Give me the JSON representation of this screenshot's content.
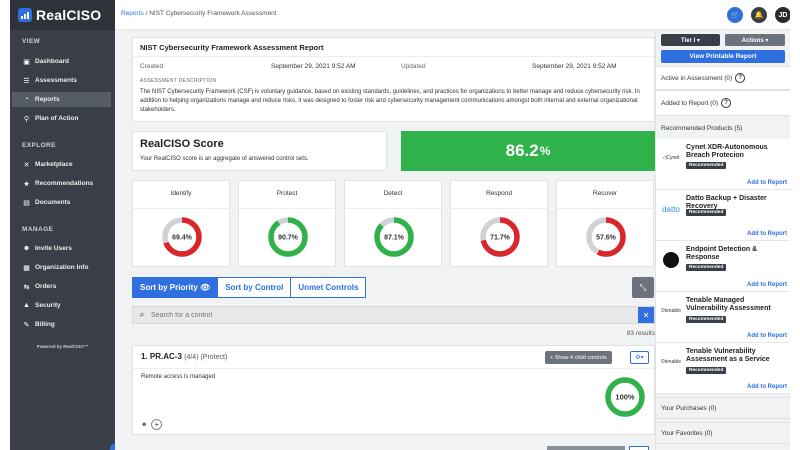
{
  "sidebar": {
    "logo": "RealCISO",
    "sections": {
      "view": "VIEW",
      "explore": "EXPLORE",
      "manage": "MANAGE"
    },
    "items": [
      {
        "label": "Dashboard",
        "icon": "dashboard-icon",
        "glyph": "▣"
      },
      {
        "label": "Assessments",
        "icon": "list-icon",
        "glyph": "☰"
      },
      {
        "label": "Reports",
        "icon": "pie-chart-icon",
        "glyph": "◔"
      },
      {
        "label": "Plan of Action",
        "icon": "pin-icon",
        "glyph": "⚲"
      },
      {
        "label": "Marketplace",
        "icon": "marketplace-icon",
        "glyph": "✕"
      },
      {
        "label": "Recommendations",
        "icon": "star-icon",
        "glyph": "★"
      },
      {
        "label": "Documents",
        "icon": "document-icon",
        "glyph": "▤"
      },
      {
        "label": "Invite Users",
        "icon": "users-icon",
        "glyph": "☻"
      },
      {
        "label": "Organization Info",
        "icon": "building-icon",
        "glyph": "▦"
      },
      {
        "label": "Orders",
        "icon": "orders-icon",
        "glyph": "⇆"
      },
      {
        "label": "Security",
        "icon": "lock-icon",
        "glyph": "🔒"
      },
      {
        "label": "Billing",
        "icon": "edit-icon",
        "glyph": "✎"
      }
    ],
    "powered": "Powered by RealCISO™"
  },
  "topbar": {
    "crumb_link": "Reports",
    "crumb_sep": "/",
    "crumb_current": "NIST Cybersecurity Framework Assessment",
    "avatar": "JD"
  },
  "report": {
    "title": "NIST Cybersecurity Framework Assessment Report",
    "created_label": "Created",
    "created_value": "September 29, 2021 9:52 AM",
    "updated_label": "Updated",
    "updated_value": "September 29, 2021 9:52 AM",
    "desc_label": "ASSESSMENT DESCRIPTION",
    "description": "The NIST Cybersecurity Framework (CSF) is voluntary guidance, based on existing standards, guidelines, and practices for organizations to better manage and reduce cybersecurity risk. In addition to helping organizations manage and reduce risks, it was designed to foster risk and cybersecurity management communications amongst both internal and external organizational stakeholders."
  },
  "score": {
    "title": "RealCISO Score",
    "subtitle": "Your RealCISO score is an aggregate of answered control sets.",
    "value": "86.2",
    "unit": "%"
  },
  "functions": [
    {
      "name": "Identify",
      "value": 69.4,
      "label": "69.4%",
      "color": "#d9262b"
    },
    {
      "name": "Protect",
      "value": 90.7,
      "label": "90.7%",
      "color": "#2fb24a"
    },
    {
      "name": "Detect",
      "value": 87.1,
      "label": "87.1%",
      "color": "#2fb24a"
    },
    {
      "name": "Respond",
      "value": 71.7,
      "label": "71.7%",
      "color": "#d9262b"
    },
    {
      "name": "Recover",
      "value": 57.6,
      "label": "57.6%",
      "color": "#d9262b"
    }
  ],
  "sort": {
    "priority": "Sort by Priority",
    "control": "Sort by Control",
    "unmet": "Unmet Controls"
  },
  "search": {
    "placeholder": "Search for a control",
    "results": "83 results"
  },
  "control": {
    "id": "1. PR.AC-3",
    "meta": "(4/4) (Protect)",
    "child_button": "+ Show 4 child controls",
    "text": "Remote access is managed",
    "value": 100,
    "label": "100%"
  },
  "right": {
    "tier": "Tier I ▾",
    "actions": "Actions ▾",
    "print": "View Printable Report",
    "active": "Active in Assessment (0)",
    "added": "Added to Report (0)",
    "recommended": "Recommended Products (5)",
    "products": [
      {
        "name": "Cynet XDR-Autonomous Breach Protecion",
        "logo": "◁Cynet",
        "badge": "Recommended",
        "add": "Add to Report"
      },
      {
        "name": "Datto Backup + Disaster Recovery",
        "logo": "datto",
        "badge": "Recommended",
        "add": "Add to Report"
      },
      {
        "name": "Endpoint Detection & Response",
        "logo": "",
        "badge": "Recommended",
        "add": "Add to Report"
      },
      {
        "name": "Tenable Managed Vulnerability Assessment",
        "logo": "©tenable",
        "badge": "Recommended",
        "add": "Add to Report"
      },
      {
        "name": "Tenable Vulnerability Assessment as a Service",
        "logo": "©tenable",
        "badge": "Recommended",
        "add": "Add to Report"
      }
    ],
    "purchases": "Your Purchases (0)",
    "favorites": "Your Favorites (0)"
  },
  "colors": {
    "accent": "#2f6fe0",
    "good": "#2fb24a",
    "bad": "#d9262b",
    "sidebar": "#3a3f47"
  }
}
